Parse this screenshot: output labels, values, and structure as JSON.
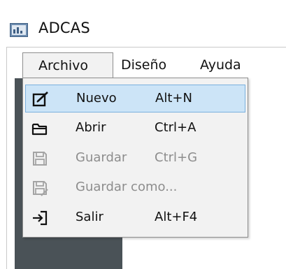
{
  "window": {
    "title": "ADCAS"
  },
  "menubar": {
    "items": [
      {
        "label": "Archivo"
      },
      {
        "label": "Diseño"
      },
      {
        "label": "Ayuda"
      }
    ]
  },
  "file_menu": {
    "items": [
      {
        "label": "Nuevo",
        "shortcut": "Alt+N",
        "icon": "new-document-icon",
        "enabled": true,
        "highlighted": true
      },
      {
        "label": "Abrir",
        "shortcut": "Ctrl+A",
        "icon": "folder-open-icon",
        "enabled": true,
        "highlighted": false
      },
      {
        "label": "Guardar",
        "shortcut": "Ctrl+G",
        "icon": "save-icon",
        "enabled": false,
        "highlighted": false
      },
      {
        "label": "Guardar como...",
        "shortcut": "",
        "icon": "save-as-icon",
        "enabled": false,
        "highlighted": false
      },
      {
        "label": "Salir",
        "shortcut": "Alt+F4",
        "icon": "exit-icon",
        "enabled": true,
        "highlighted": false
      }
    ]
  },
  "colors": {
    "highlight_bg": "#cce4f7",
    "highlight_border": "#7ab0de",
    "menu_bg": "#f2f2f2",
    "side_panel": "#4a5257",
    "disabled_text": "#8d8d8d"
  }
}
